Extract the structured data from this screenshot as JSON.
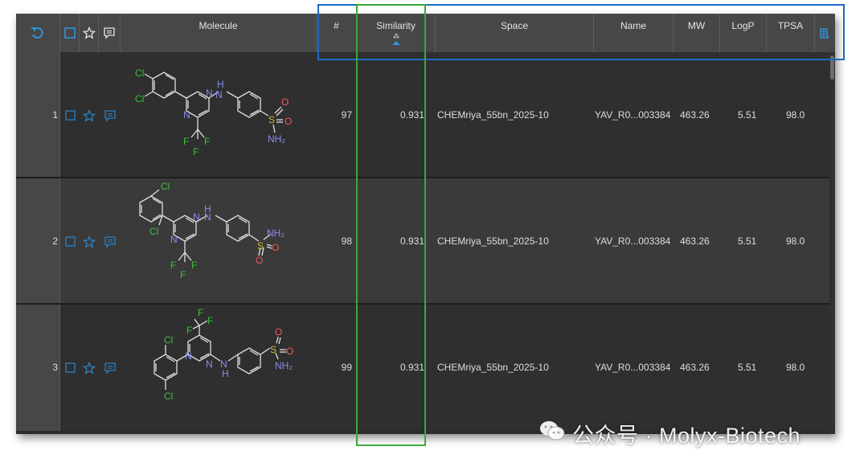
{
  "header": {
    "molecule": "Molecule",
    "number": "#",
    "similarity": "Similarity",
    "space": "Space",
    "name": "Name",
    "mw": "MW",
    "logp": "LogP",
    "tpsa": "TPSA"
  },
  "icons": {
    "undo": "undo-icon",
    "select_all": "checkbox-icon",
    "favorite": "star-icon",
    "comment": "comment-icon",
    "sort": "sort-ascending-icon",
    "columns": "column-settings-icon"
  },
  "rows": [
    {
      "index": "1",
      "number": "97",
      "similarity": "0.931",
      "space": "CHEMriya_55bn_2025-10",
      "name": "YAV_R0...003384",
      "mw": "463.26",
      "logp": "5.51",
      "tpsa": "98.0",
      "mol": {
        "cl1": "Cl",
        "cl2": "Cl",
        "n1": "N",
        "n2": "N",
        "nh": "H",
        "nh_n": "N",
        "s": "S",
        "o1": "O",
        "o2": "O",
        "nh2": "NH₂",
        "f1": "F",
        "f2": "F",
        "f3": "F"
      }
    },
    {
      "index": "2",
      "number": "98",
      "similarity": "0.931",
      "space": "CHEMriya_55bn_2025-10",
      "name": "YAV_R0...003384",
      "mw": "463.26",
      "logp": "5.51",
      "tpsa": "98.0",
      "mol": {
        "cl1": "Cl",
        "cl2": "Cl",
        "n1": "N",
        "n2": "N",
        "nh": "H",
        "nh_n": "N",
        "s": "S",
        "o1": "O",
        "o2": "O",
        "nh2": "NH₂",
        "f1": "F",
        "f2": "F",
        "f3": "F"
      }
    },
    {
      "index": "3",
      "number": "99",
      "similarity": "0.931",
      "space": "CHEMriya_55bn_2025-10",
      "name": "YAV_R0...003384",
      "mw": "463.26",
      "logp": "5.51",
      "tpsa": "98.0",
      "mol": {
        "cl1": "Cl",
        "cl2": "Cl",
        "n1": "N",
        "n2": "N",
        "nh": "H",
        "nh_n": "N",
        "s": "S",
        "o1": "O",
        "o2": "O",
        "nh2": "NH₂",
        "f1": "F",
        "f2": "F",
        "f3": "F"
      }
    }
  ],
  "watermark": {
    "text": "公众号 · Molyx-Biotech"
  },
  "colors": {
    "accent": "#2f95d6",
    "highlight_blue": "#1a6cc2",
    "highlight_green": "#3aa93a",
    "chlorine": "#3fc03f",
    "nitrogen": "#8c8cf2",
    "oxygen": "#ee5a5a",
    "sulfur": "#cbbb3a",
    "fluorine": "#36c236"
  }
}
